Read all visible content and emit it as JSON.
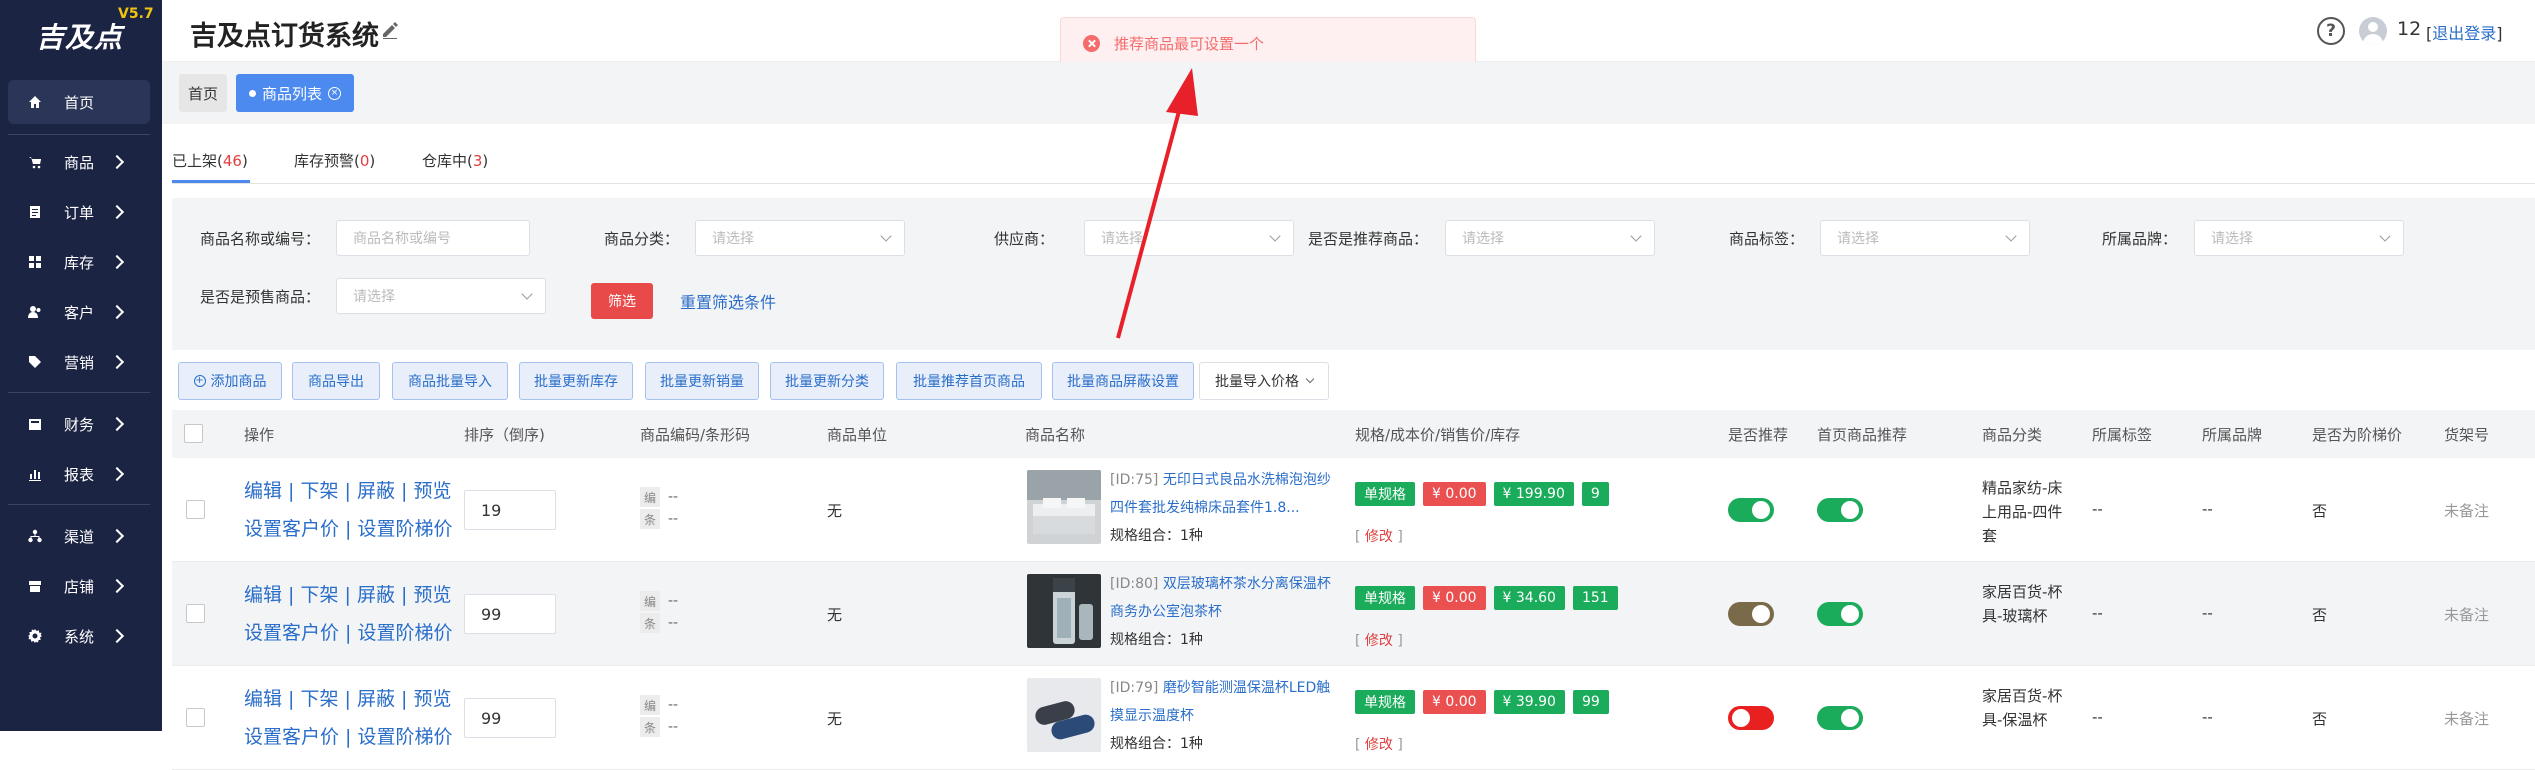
{
  "app": {
    "logo": "吉及点",
    "version": "V5.7",
    "title": "吉及点订货系统"
  },
  "sidebar": {
    "items": [
      {
        "label": "首页",
        "icon": "home-icon",
        "arrow": false
      },
      {
        "label": "商品",
        "icon": "cart-icon",
        "arrow": true
      },
      {
        "label": "订单",
        "icon": "order-icon",
        "arrow": true
      },
      {
        "label": "库存",
        "icon": "inventory-icon",
        "arrow": true
      },
      {
        "label": "客户",
        "icon": "customer-icon",
        "arrow": true
      },
      {
        "label": "营销",
        "icon": "tag-icon",
        "arrow": true
      },
      {
        "label": "财务",
        "icon": "finance-icon",
        "arrow": true
      },
      {
        "label": "报表",
        "icon": "chart-icon",
        "arrow": true
      },
      {
        "label": "渠道",
        "icon": "channel-icon",
        "arrow": true
      },
      {
        "label": "店铺",
        "icon": "store-icon",
        "arrow": true
      },
      {
        "label": "系统",
        "icon": "gear-icon",
        "arrow": true
      }
    ]
  },
  "header": {
    "help": "?",
    "user": "12",
    "logout_l": "[",
    "logout": "退出登录",
    "logout_r": "]"
  },
  "toast": {
    "message": "推荐商品最可设置一个"
  },
  "tagsbar": {
    "home": "首页",
    "current": "商品列表",
    "close": "×"
  },
  "tabs": [
    {
      "label": "已上架(",
      "count": "46",
      "tail": ")"
    },
    {
      "label": "库存预警(",
      "count": "0",
      "tail": ")"
    },
    {
      "label": "仓库中(",
      "count": "3",
      "tail": ")"
    }
  ],
  "filters": {
    "name_label": "商品名称或编号：",
    "name_placeholder": "商品名称或编号",
    "category_label": "商品分类：",
    "category_placeholder": "请选择",
    "supplier_label": "供应商：",
    "supplier_placeholder": "请选择",
    "recommend_label": "是否是推荐商品：",
    "recommend_placeholder": "请选择",
    "tag_label": "商品标签：",
    "tag_placeholder": "请选择",
    "brand_label": "所属品牌：",
    "brand_placeholder": "请选择",
    "presale_label": "是否是预售商品：",
    "presale_placeholder": "请选择",
    "filter_button": "筛选",
    "reset_button": "重置筛选条件"
  },
  "toolbar": {
    "add": "添加商品",
    "export": "商品导出",
    "batch_import": "商品批量导入",
    "update_stock": "批量更新库存",
    "update_sales": "批量更新销量",
    "update_category": "批量更新分类",
    "batch_recommend": "批量推荐首页商品",
    "batch_hide": "批量商品屏蔽设置",
    "import_price": "批量导入价格"
  },
  "table": {
    "headers": {
      "ops": "操作",
      "sort": "排序（倒序)",
      "code": "商品编码/条形码",
      "unit": "商品单位",
      "name": "商品名称",
      "spec": "规格/成本价/销售价/库存",
      "recommend": "是否推荐",
      "home_recommend": "首页商品推荐",
      "category": "商品分类",
      "tag": "所属标签",
      "brand": "所属品牌",
      "tier": "是否为阶梯价",
      "shelf": "货架号"
    },
    "op_line1": "编辑 | 下架 | 屏蔽 | 预览",
    "op_line2": "设置客户价 | 设置阶梯价",
    "code_label_1": "编",
    "code_label_2": "条",
    "code_empty": "--",
    "spec_label": "单规格",
    "modify_l": "[",
    "modify": " 修改 ",
    "modify_r": "]",
    "rows": [
      {
        "sort": "19",
        "unit": "无",
        "id": "[ID:75]",
        "name": "无印日式良品水洗棉泡泡纱四件套批发纯棉床品套件1.8...",
        "combo": "规格组合：1种",
        "cost": "¥ 0.00",
        "price": "¥ 199.90",
        "stock": "9",
        "recommend": "on",
        "home": "on",
        "category": "精品家纺-床上用品-四件套",
        "tag": "--",
        "brand": "--",
        "tier": "否",
        "shelf": "未备注"
      },
      {
        "sort": "99",
        "unit": "无",
        "id": "[ID:80]",
        "name": "双层玻璃杯茶水分离保温杯商务办公室泡茶杯",
        "combo": "规格组合：1种",
        "cost": "¥ 0.00",
        "price": "¥ 34.60",
        "stock": "151",
        "recommend": "olive",
        "home": "on",
        "category": "家居百货-杯具-玻璃杯",
        "tag": "--",
        "brand": "--",
        "tier": "否",
        "shelf": "未备注"
      },
      {
        "sort": "99",
        "unit": "无",
        "id": "[ID:79]",
        "name": "磨砂智能测温保温杯LED触摸显示温度杯",
        "combo": "规格组合：1种",
        "cost": "¥ 0.00",
        "price": "¥ 39.90",
        "stock": "99",
        "recommend": "off",
        "home": "on",
        "category": "家居百货-杯具-保温杯",
        "tag": "--",
        "brand": "--",
        "tier": "否",
        "shelf": "未备注"
      }
    ]
  },
  "colors": {
    "sidebar": "#1c2444",
    "primary": "#4d8af0",
    "link": "#2a6ec9",
    "danger": "#ea5050",
    "success": "#1aab5b",
    "arrow": "#e8202a"
  }
}
